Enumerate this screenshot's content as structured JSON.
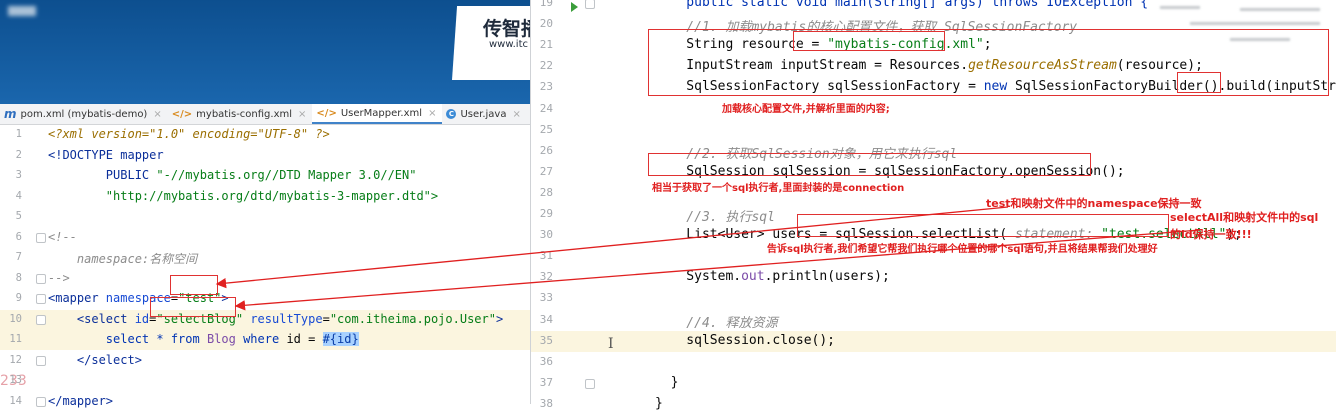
{
  "banner": {
    "brand_title": "传智播",
    "brand_url": "www.itc"
  },
  "left_tabs": [
    {
      "label": "pom.xml (mybatis-demo)",
      "icon": "maven-icon"
    },
    {
      "label": "mybatis-config.xml",
      "icon": "xml-file-icon"
    },
    {
      "label": "UserMapper.xml",
      "icon": "xml-file-icon",
      "active": true
    },
    {
      "label": "User.java",
      "icon": "class-icon"
    }
  ],
  "tab_close_glyph": "×",
  "left_editor": {
    "watermark": "233",
    "lines": [
      {
        "num": "1",
        "parts": [
          {
            "t": "<?xml version=\"1.0\" encoding=\"UTF-8\" ?>",
            "c": "t-pi"
          }
        ]
      },
      {
        "num": "2",
        "parts": [
          {
            "t": "<!DOCTYPE mapper",
            "c": "t-tag"
          }
        ]
      },
      {
        "num": "3",
        "parts": [
          {
            "t": "        PUBLIC ",
            "c": "t-tag"
          },
          {
            "t": "\"-//mybatis.org//DTD Mapper 3.0//EN\"",
            "c": "t-val"
          }
        ]
      },
      {
        "num": "4",
        "parts": [
          {
            "t": "        \"http://mybatis.org/dtd/mybatis-3-mapper.dtd\">",
            "c": "t-val"
          }
        ]
      },
      {
        "num": "5",
        "parts": []
      },
      {
        "num": "6",
        "parts": [
          {
            "t": "<!--",
            "c": "t-com"
          }
        ]
      },
      {
        "num": "7",
        "parts": [
          {
            "t": "    namespace:名称空间",
            "c": "t-com"
          }
        ]
      },
      {
        "num": "8",
        "parts": [
          {
            "t": "-->",
            "c": "t-com"
          }
        ]
      },
      {
        "num": "9",
        "parts": [
          {
            "t": "<mapper ",
            "c": "t-tag"
          },
          {
            "t": "namespace",
            "c": "t-attr"
          },
          {
            "t": "=",
            "c": ""
          },
          {
            "t": "\"test\"",
            "c": "t-val"
          },
          {
            "t": ">",
            "c": "t-tag"
          }
        ]
      },
      {
        "num": "10",
        "hl": true,
        "parts": [
          {
            "t": "    <select ",
            "c": "t-tag"
          },
          {
            "t": "id",
            "c": "t-attr"
          },
          {
            "t": "=",
            "c": ""
          },
          {
            "t": "\"selectBlog\"",
            "c": "t-val"
          },
          {
            "t": " resultType",
            "c": "t-attr"
          },
          {
            "t": "=",
            "c": ""
          },
          {
            "t": "\"com.itheima.pojo.User\"",
            "c": "t-val"
          },
          {
            "t": ">",
            "c": "t-tag"
          }
        ]
      },
      {
        "num": "11",
        "hl": true,
        "parts": [
          {
            "t": "        select * ",
            "c": "t-key"
          },
          {
            "t": "from ",
            "c": "t-key"
          },
          {
            "t": "Blog ",
            "c": "t-field"
          },
          {
            "t": "where ",
            "c": "t-key"
          },
          {
            "t": "id = ",
            "c": ""
          },
          {
            "t": "#{id}",
            "c": "t-param"
          }
        ]
      },
      {
        "num": "12",
        "parts": [
          {
            "t": "    </select>",
            "c": "t-tag"
          }
        ]
      },
      {
        "num": "13",
        "parts": []
      },
      {
        "num": "14",
        "parts": [
          {
            "t": "</mapper>",
            "c": "t-tag"
          }
        ]
      }
    ]
  },
  "right_editor": {
    "lines": [
      {
        "num": "19",
        "parts": [
          {
            "t": "    public static void main(String[] args) throws IOException {",
            "c": "t-key"
          }
        ]
      },
      {
        "num": "20",
        "parts": [
          {
            "t": "    //1. 加载mybatis的核心配置文件，获取 SqlSessionFactory",
            "c": "t-com"
          }
        ]
      },
      {
        "num": "21",
        "parts": [
          {
            "t": "    String resource = ",
            "c": ""
          },
          {
            "t": "\"mybatis-config.xml\"",
            "c": "t-val"
          },
          {
            "t": ";",
            "c": ""
          }
        ]
      },
      {
        "num": "22",
        "parts": [
          {
            "t": "    InputStream inputStream = Resources.",
            "c": ""
          },
          {
            "t": "getResourceAsStream",
            "c": "t-pi"
          },
          {
            "t": "(resource);",
            "c": ""
          }
        ]
      },
      {
        "num": "23",
        "parts": [
          {
            "t": "    SqlSessionFactory sqlSessionFactory = ",
            "c": ""
          },
          {
            "t": "new ",
            "c": "t-key"
          },
          {
            "t": "SqlSessionFactoryBuilder().build(inputStream);",
            "c": ""
          }
        ]
      },
      {
        "num": "24",
        "parts": []
      },
      {
        "num": "25",
        "parts": []
      },
      {
        "num": "26",
        "parts": [
          {
            "t": "    //2. 获取SqlSession对象，用它来执行sql",
            "c": "t-com"
          }
        ]
      },
      {
        "num": "27",
        "parts": [
          {
            "t": "    SqlSession sqlSession = sqlSessionFactory.openSession();",
            "c": ""
          }
        ]
      },
      {
        "num": "28",
        "parts": []
      },
      {
        "num": "29",
        "parts": [
          {
            "t": "    //3. 执行sql",
            "c": "t-com"
          }
        ]
      },
      {
        "num": "30",
        "parts": [
          {
            "t": "    List<User> users = sqlSession.selectList( ",
            "c": ""
          },
          {
            "t": "statement: ",
            "c": "t-com"
          },
          {
            "t": "\"test.selectAll\"",
            "c": "t-val"
          },
          {
            "t": ");",
            "c": ""
          }
        ]
      },
      {
        "num": "31",
        "parts": []
      },
      {
        "num": "32",
        "parts": [
          {
            "t": "    System.",
            "c": ""
          },
          {
            "t": "out",
            "c": "t-field"
          },
          {
            "t": ".println(users);",
            "c": ""
          }
        ]
      },
      {
        "num": "33",
        "parts": []
      },
      {
        "num": "34",
        "parts": [
          {
            "t": "    //4. 释放资源",
            "c": "t-com"
          }
        ]
      },
      {
        "num": "35",
        "hl": true,
        "parts": [
          {
            "t": "    sqlSession.close();",
            "c": ""
          }
        ]
      },
      {
        "num": "36",
        "parts": []
      },
      {
        "num": "37",
        "parts": [
          {
            "t": "  }",
            "c": ""
          }
        ]
      },
      {
        "num": "38",
        "parts": [
          {
            "t": "}",
            "c": ""
          }
        ]
      }
    ]
  },
  "annotations": {
    "load_config": "加载核心配置文件,并解析里面的内容;",
    "get_session": "相当于获取了一个sql执行者,里面封装的是connection",
    "namespace_note": "test和映射文件中的namespace保持一致",
    "selectall_note_1": "selectAll和映射文件中的sql",
    "selectall_note_2": "的id保持一致!!!",
    "tell_sql": "告诉sql执行者,我们希望它帮我们执行哪个位置的哪个sql语句,并且将结果帮我们处理好"
  },
  "colors": {
    "annotation": "#e02020",
    "banner": "#1a66ad",
    "line_highlight": "#fbf5df"
  }
}
